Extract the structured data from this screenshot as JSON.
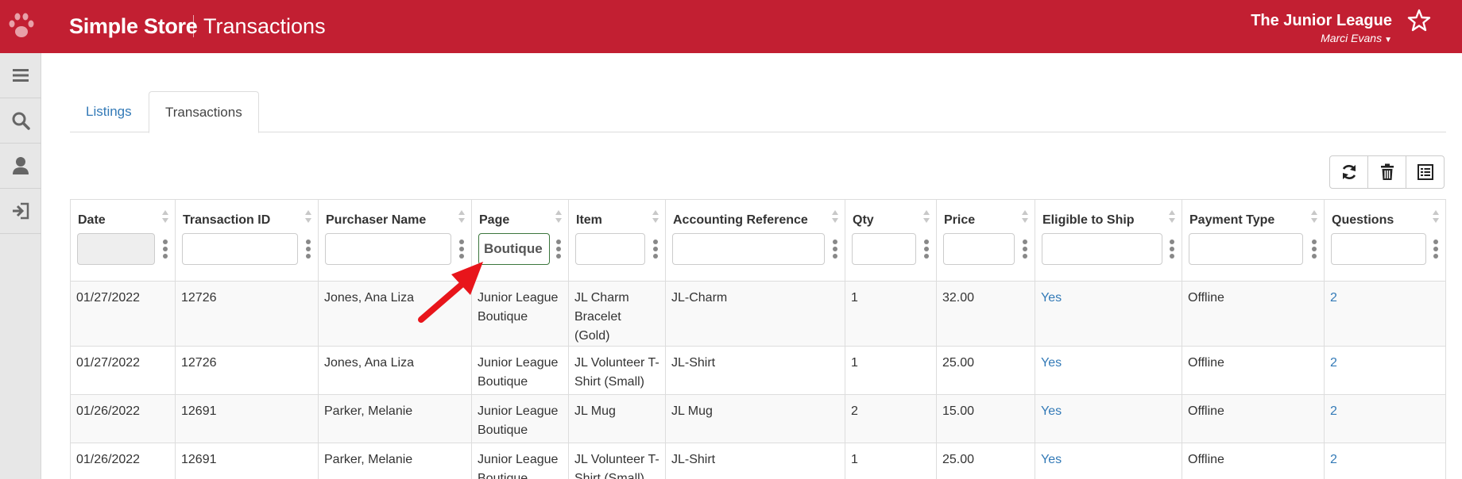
{
  "header": {
    "app_name": "Simple Store",
    "page_title": "Transactions",
    "org_name": "The Junior League",
    "user_name": "Marci Evans",
    "icons": {
      "logo": "paw-icon",
      "caret": "caret-down-icon",
      "favorite": "star-icon"
    }
  },
  "sidebar": {
    "items": [
      {
        "icon": "menu-icon"
      },
      {
        "icon": "search-icon"
      },
      {
        "icon": "user-icon"
      },
      {
        "icon": "logout-icon"
      }
    ]
  },
  "tabs": [
    {
      "label": "Listings",
      "active": false
    },
    {
      "label": "Transactions",
      "active": true
    }
  ],
  "toolbar": {
    "buttons": [
      {
        "icon": "refresh-icon"
      },
      {
        "icon": "trash-icon"
      },
      {
        "icon": "export-list-icon"
      }
    ]
  },
  "table": {
    "columns": [
      {
        "label": "Date",
        "filter_value": "",
        "filter_disabled": true
      },
      {
        "label": "Transaction ID",
        "filter_value": ""
      },
      {
        "label": "Purchaser Name",
        "filter_value": ""
      },
      {
        "label": "Page",
        "filter_value": "Boutique"
      },
      {
        "label": "Item",
        "filter_value": ""
      },
      {
        "label": "Accounting Reference",
        "filter_value": ""
      },
      {
        "label": "Qty",
        "filter_value": ""
      },
      {
        "label": "Price",
        "filter_value": ""
      },
      {
        "label": "Eligible to Ship",
        "filter_value": ""
      },
      {
        "label": "Payment Type",
        "filter_value": ""
      },
      {
        "label": "Questions",
        "filter_value": ""
      }
    ],
    "rows": [
      {
        "date": "01/27/2022",
        "transaction_id": "12726",
        "purchaser": "Jones, Ana Liza",
        "page": "Junior League Boutique",
        "item": "JL Charm Bracelet (Gold)",
        "accounting_ref": "JL-Charm",
        "qty": "1",
        "price": "32.00",
        "eligible": "Yes",
        "payment_type": "Offline",
        "questions": "2"
      },
      {
        "date": "01/27/2022",
        "transaction_id": "12726",
        "purchaser": "Jones, Ana Liza",
        "page": "Junior League Boutique",
        "item": "JL Volunteer T-Shirt (Small)",
        "accounting_ref": "JL-Shirt",
        "qty": "1",
        "price": "25.00",
        "eligible": "Yes",
        "payment_type": "Offline",
        "questions": "2"
      },
      {
        "date": "01/26/2022",
        "transaction_id": "12691",
        "purchaser": "Parker, Melanie",
        "page": "Junior League Boutique",
        "item": "JL Mug",
        "accounting_ref": "JL Mug",
        "qty": "2",
        "price": "15.00",
        "eligible": "Yes",
        "payment_type": "Offline",
        "questions": "2"
      },
      {
        "date": "01/26/2022",
        "transaction_id": "12691",
        "purchaser": "Parker, Melanie",
        "page": "Junior League Boutique",
        "item": "JL Volunteer T-Shirt (Small)",
        "accounting_ref": "JL-Shirt",
        "qty": "1",
        "price": "25.00",
        "eligible": "Yes",
        "payment_type": "Offline",
        "questions": "2"
      }
    ]
  },
  "annotation": {
    "icon": "red-arrow-icon",
    "color": "#e8151b"
  },
  "colors": {
    "brand": "#c21f32",
    "link": "#337ab7",
    "active_filter_border": "#3c763d"
  }
}
